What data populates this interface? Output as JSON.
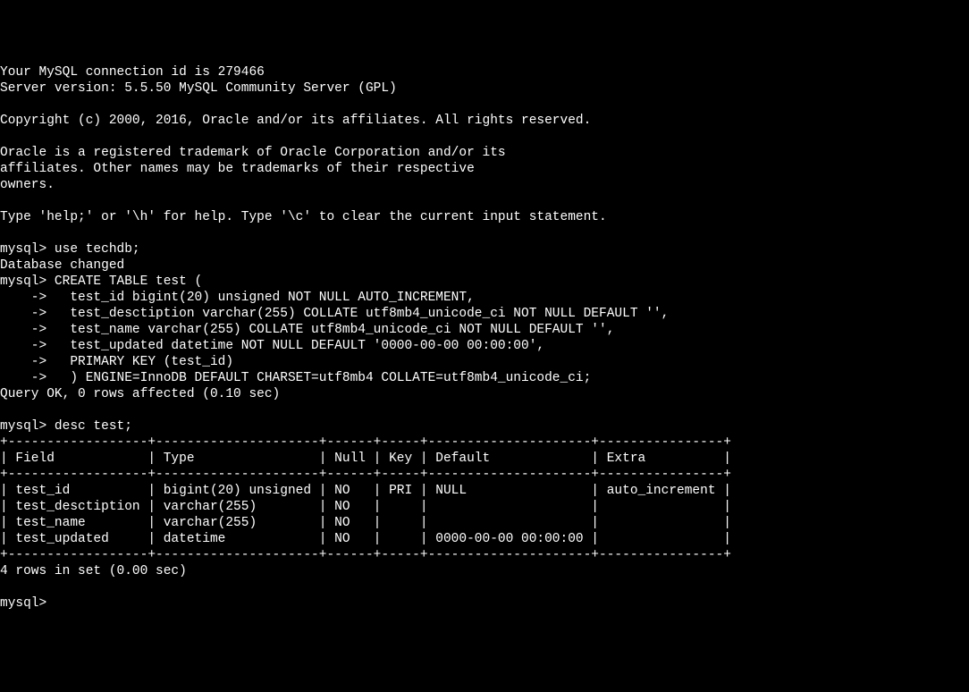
{
  "lines": [
    "Your MySQL connection id is 279466",
    "Server version: 5.5.50 MySQL Community Server (GPL)",
    "",
    "Copyright (c) 2000, 2016, Oracle and/or its affiliates. All rights reserved.",
    "",
    "Oracle is a registered trademark of Oracle Corporation and/or its",
    "affiliates. Other names may be trademarks of their respective",
    "owners.",
    "",
    "Type 'help;' or '\\h' for help. Type '\\c' to clear the current input statement.",
    "",
    "mysql> use techdb;",
    "Database changed",
    "mysql> CREATE TABLE test (",
    "    ->   test_id bigint(20) unsigned NOT NULL AUTO_INCREMENT,",
    "    ->   test_desctiption varchar(255) COLLATE utf8mb4_unicode_ci NOT NULL DEFAULT '',",
    "    ->   test_name varchar(255) COLLATE utf8mb4_unicode_ci NOT NULL DEFAULT '',",
    "    ->   test_updated datetime NOT NULL DEFAULT '0000-00-00 00:00:00',",
    "    ->   PRIMARY KEY (test_id)",
    "    ->   ) ENGINE=InnoDB DEFAULT CHARSET=utf8mb4 COLLATE=utf8mb4_unicode_ci;",
    "Query OK, 0 rows affected (0.10 sec)",
    "",
    "mysql> desc test;",
    "+------------------+---------------------+------+-----+---------------------+----------------+",
    "| Field            | Type                | Null | Key | Default             | Extra          |",
    "+------------------+---------------------+------+-----+---------------------+----------------+",
    "| test_id          | bigint(20) unsigned | NO   | PRI | NULL                | auto_increment |",
    "| test_desctiption | varchar(255)        | NO   |     |                     |                |",
    "| test_name        | varchar(255)        | NO   |     |                     |                |",
    "| test_updated     | datetime            | NO   |     | 0000-00-00 00:00:00 |                |",
    "+------------------+---------------------+------+-----+---------------------+----------------+",
    "4 rows in set (0.00 sec)",
    "",
    "mysql> "
  ],
  "prompt": "mysql> ",
  "connection_id": "279466",
  "server_version": "5.5.50 MySQL Community Server (GPL)",
  "database": "techdb",
  "query_create_result": "Query OK, 0 rows affected (0.10 sec)",
  "desc_result_footer": "4 rows in set (0.00 sec)",
  "desc_table": {
    "columns": [
      "Field",
      "Type",
      "Null",
      "Key",
      "Default",
      "Extra"
    ],
    "rows": [
      [
        "test_id",
        "bigint(20) unsigned",
        "NO",
        "PRI",
        "NULL",
        "auto_increment"
      ],
      [
        "test_desctiption",
        "varchar(255)",
        "NO",
        "",
        "",
        ""
      ],
      [
        "test_name",
        "varchar(255)",
        "NO",
        "",
        "",
        ""
      ],
      [
        "test_updated",
        "datetime",
        "NO",
        "",
        "0000-00-00 00:00:00",
        ""
      ]
    ]
  }
}
